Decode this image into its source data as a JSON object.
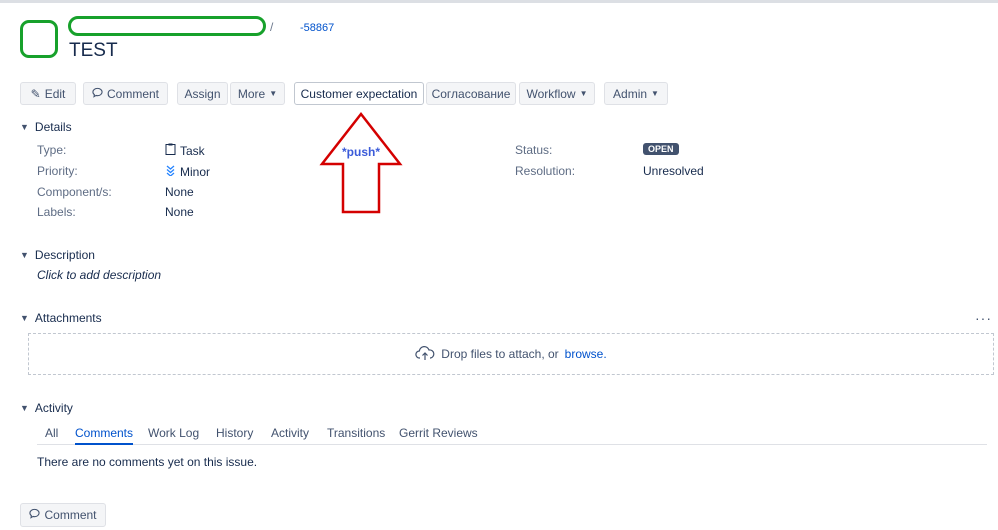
{
  "header": {
    "separator": "/",
    "issue_key": "-58867",
    "title": "TEST"
  },
  "toolbar": {
    "edit": "Edit",
    "comment": "Comment",
    "assign": "Assign",
    "more": "More",
    "customer_expectation": "Customer expectation",
    "approval": "Согласование",
    "workflow": "Workflow",
    "admin": "Admin"
  },
  "annotation": {
    "push": "*push*"
  },
  "details": {
    "heading": "Details",
    "type_label": "Type:",
    "type_value": "Task",
    "priority_label": "Priority:",
    "priority_value": "Minor",
    "components_label": "Component/s:",
    "components_value": "None",
    "labels_label": "Labels:",
    "labels_value": "None",
    "status_label": "Status:",
    "status_value": "OPEN",
    "resolution_label": "Resolution:",
    "resolution_value": "Unresolved"
  },
  "description": {
    "heading": "Description",
    "placeholder": "Click to add description"
  },
  "attachments": {
    "heading": "Attachments",
    "more": "···",
    "drop_text": "Drop files to attach, or",
    "browse": "browse."
  },
  "activity": {
    "heading": "Activity",
    "tabs": [
      "All",
      "Comments",
      "Work Log",
      "History",
      "Activity",
      "Transitions",
      "Gerrit Reviews"
    ],
    "empty": "There are no comments yet on this issue."
  },
  "footer": {
    "comment": "Comment"
  },
  "colors": {
    "accent": "#0052cc",
    "highlight": "#17a12b",
    "annotation": "#d40000"
  }
}
